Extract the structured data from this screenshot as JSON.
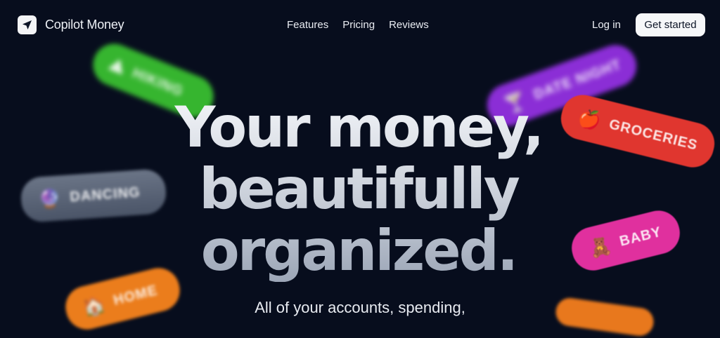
{
  "nav": {
    "brand": "Copilot Money",
    "links": [
      "Features",
      "Pricing",
      "Reviews"
    ],
    "login": "Log in",
    "cta": "Get started"
  },
  "hero": {
    "line1": "Your money,",
    "line2": "beautifully",
    "line3": "organized.",
    "subtitle": "All of your accounts, spending,"
  },
  "tags": {
    "hiking": {
      "label": "HIKING",
      "icon": "mountain-icon",
      "color": "#38b832"
    },
    "dancing": {
      "label": "DANCING",
      "icon": "mirror-ball-icon",
      "color": "#5a6577"
    },
    "home": {
      "label": "HOME",
      "icon": "house-icon",
      "color": "#e87c1f"
    },
    "date_night": {
      "label": "DATE NIGHT",
      "icon": "cocktail-icon",
      "color": "#8d2fd8"
    },
    "groceries": {
      "label": "GROCERIES",
      "icon": "apple-icon",
      "color": "#e0352f"
    },
    "baby": {
      "label": "BABY",
      "icon": "teddy-bear-icon",
      "color": "#e0309e"
    }
  },
  "colors": {
    "background": "#070d1d",
    "cta_bg": "#f6f7f9"
  }
}
